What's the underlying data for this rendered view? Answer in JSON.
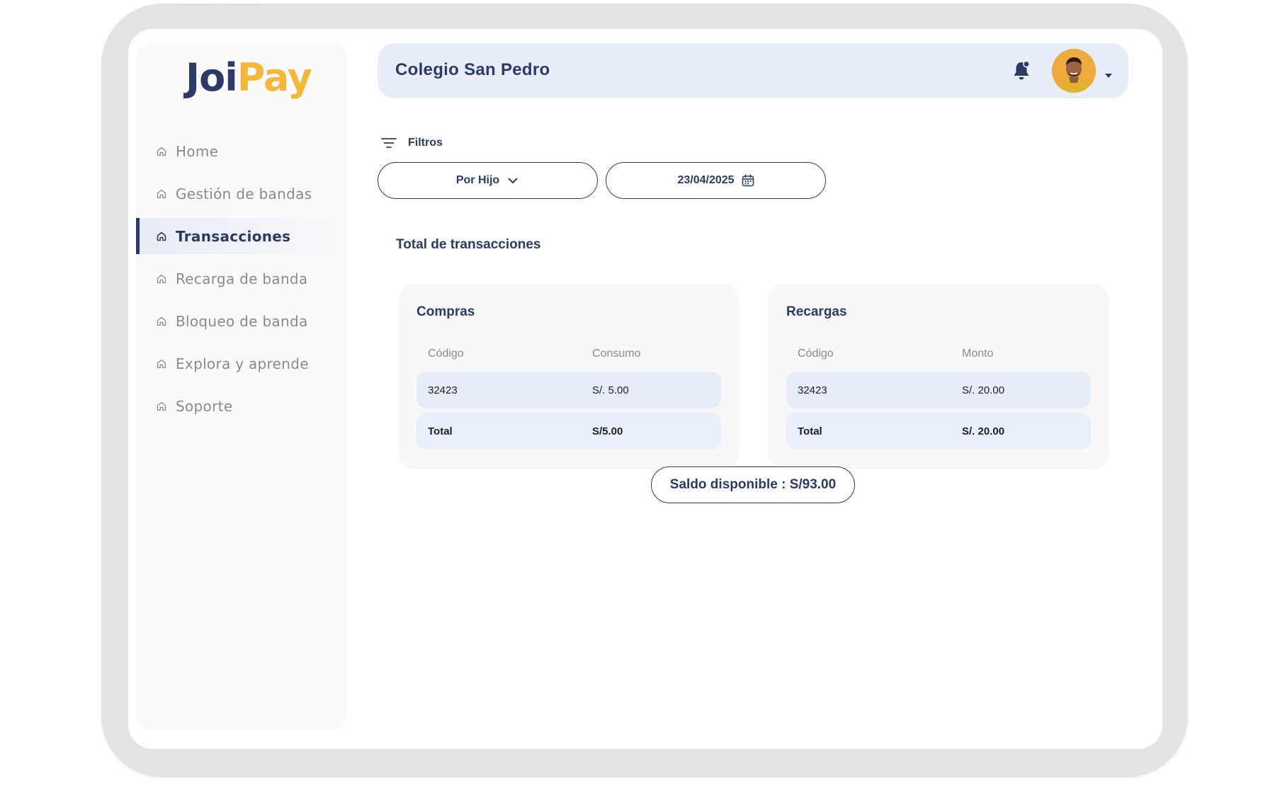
{
  "brand": {
    "logo_part1": "Joi",
    "logo_part2": "Pay",
    "colors": {
      "primary": "#2b3a67",
      "accent": "#f4b73a"
    }
  },
  "sidebar": {
    "items": [
      {
        "label": "Home",
        "icon": "home-icon",
        "active": false
      },
      {
        "label": "Gestión de bandas",
        "icon": "home-icon",
        "active": false
      },
      {
        "label": "Transacciones",
        "icon": "home-icon",
        "active": true
      },
      {
        "label": "Recarga de banda",
        "icon": "home-icon",
        "active": false
      },
      {
        "label": "Bloqueo de banda",
        "icon": "home-icon",
        "active": false
      },
      {
        "label": "Explora y aprende",
        "icon": "home-icon",
        "active": false
      },
      {
        "label": "Soporte",
        "icon": "home-icon",
        "active": false
      }
    ]
  },
  "header": {
    "title": "Colegio  San  Pedro",
    "bell_icon": "bell-icon",
    "avatar_icon": "user-avatar"
  },
  "filters": {
    "label": "Filtros",
    "by_child": "Por Hijo",
    "date": "23/04/2025"
  },
  "summary": {
    "title": "Total de transacciones"
  },
  "purchases": {
    "title": "Compras",
    "headers": [
      "Código",
      "Consumo"
    ],
    "rows": [
      {
        "code": "32423",
        "amount": "S/. 5.00"
      }
    ],
    "total_label": "Total",
    "total_value": "S/5.00"
  },
  "recharges": {
    "title": "Recargas",
    "headers": [
      "Código",
      "Monto"
    ],
    "rows": [
      {
        "code": "32423",
        "amount": "S/. 20.00"
      }
    ],
    "total_label": "Total",
    "total_value": "S/. 20.00"
  },
  "balance": {
    "label": "Saldo disponible : S/93.00"
  }
}
